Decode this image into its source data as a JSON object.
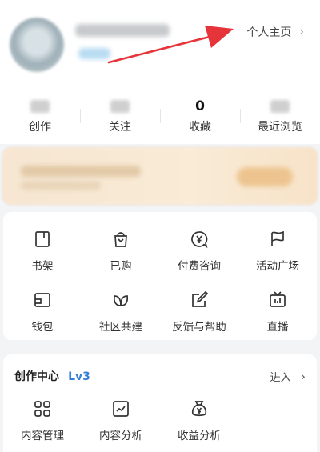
{
  "header": {
    "homepage_label": "个人主页",
    "homepage_chevron": "›"
  },
  "stats": [
    {
      "value": "",
      "label": "创作"
    },
    {
      "value": "",
      "label": "关注"
    },
    {
      "value": "0",
      "label": "收藏"
    },
    {
      "value": "",
      "label": "最近浏览"
    }
  ],
  "services": [
    {
      "label": "书架",
      "icon": "bookshelf-icon"
    },
    {
      "label": "已购",
      "icon": "shopping-bag-icon"
    },
    {
      "label": "付费咨询",
      "icon": "paid-consult-icon"
    },
    {
      "label": "活动广场",
      "icon": "flag-icon"
    },
    {
      "label": "钱包",
      "icon": "wallet-icon"
    },
    {
      "label": "社区共建",
      "icon": "community-icon"
    },
    {
      "label": "反馈与帮助",
      "icon": "feedback-icon"
    },
    {
      "label": "直播",
      "icon": "live-tv-icon"
    }
  ],
  "creation_center": {
    "title": "创作中心",
    "level": "Lv3",
    "enter_label": "进入",
    "enter_chevron": "›",
    "items": [
      {
        "label": "内容管理",
        "icon": "content-grid-icon"
      },
      {
        "label": "内容分析",
        "icon": "chart-icon"
      },
      {
        "label": "收益分析",
        "icon": "money-bag-icon"
      }
    ]
  },
  "colors": {
    "accent_level": "#3a7fd6",
    "annotation_arrow": "#e6353a"
  }
}
